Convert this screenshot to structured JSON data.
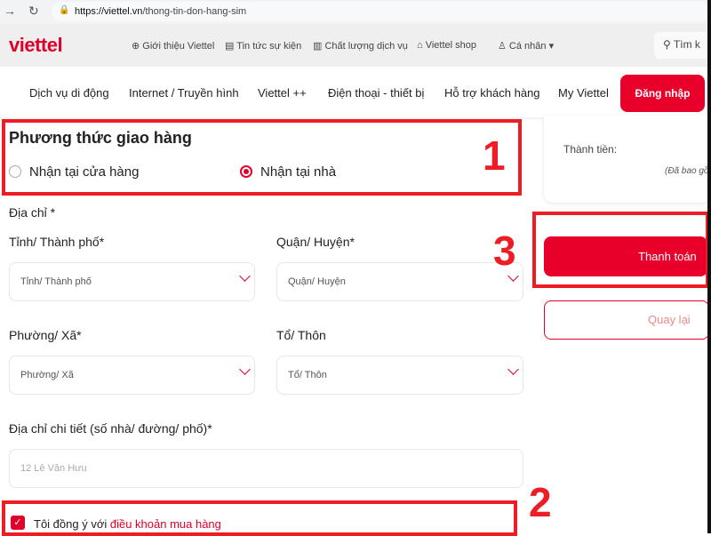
{
  "browser": {
    "url_host": "https://viettel.vn",
    "url_path": "/thong-tin-don-hang-sim"
  },
  "header": {
    "logo": "viettel",
    "links": [
      "Giới thiệu Viettel",
      "Tin tức sự kiện",
      "Chất lượng dịch vụ",
      "Viettel shop",
      "Cá nhân"
    ],
    "search_placeholder": "Tìm k"
  },
  "nav": {
    "items": [
      "Dịch vụ di động",
      "Internet / Truyền hình",
      "Viettel ++",
      "Điện thoại - thiết bị",
      "Hỗ trợ khách hàng",
      "My Viettel"
    ],
    "login": "Đăng nhập"
  },
  "delivery": {
    "title": "Phương thức giao hàng",
    "options": [
      "Nhận tại cửa hàng",
      "Nhận tại nhà"
    ],
    "selected": "Nhận tại nhà"
  },
  "address": {
    "title": "Địa chỉ *",
    "province_label": "Tỉnh/ Thành phố*",
    "province_placeholder": "Tỉnh/ Thành phố",
    "district_label": "Quận/ Huyện*",
    "district_placeholder": "Quận/ Huyện",
    "ward_label": "Phường/ Xã*",
    "ward_placeholder": "Phường/ Xã",
    "hamlet_label": "Tổ/ Thôn",
    "hamlet_placeholder": "Tổ/ Thôn",
    "detail_label": "Địa chỉ chi tiết (số nhà/ đường/ phố)*",
    "detail_placeholder": "12 Lê Văn Hưu"
  },
  "agree": {
    "text": "Tôi đồng ý với ",
    "link": "điều khoản mua hàng",
    "checked": true
  },
  "summary": {
    "total_label": "Thành tiền:",
    "note": "(Đã bao gồ"
  },
  "actions": {
    "pay": "Thanh toán",
    "back": "Quay lại"
  },
  "annotations": [
    "1",
    "2",
    "3"
  ],
  "colors": {
    "brand": "#e8002b",
    "annotation": "#ee1c25"
  }
}
